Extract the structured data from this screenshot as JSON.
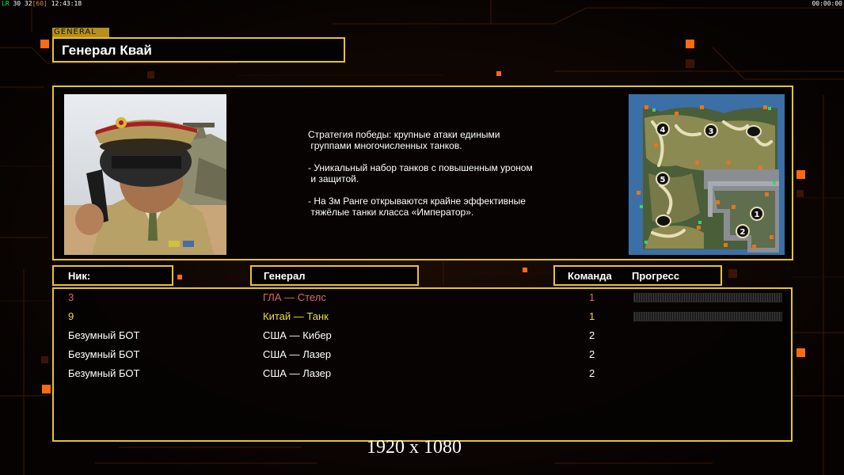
{
  "hud": {
    "fps_prefix": "LR",
    "fps_values": "30 32",
    "fps_bracket": "[60]",
    "clock": "12:43:18",
    "timer": "00:00:00"
  },
  "general": {
    "tag": "GENERAL",
    "name": "Генерал Квай"
  },
  "description": [
    "Стратегия победы: крупные атаки едиными\n группами многочисленных танков.",
    "- Уникальный набор танков с повышенным уроном\n и защитой.",
    "- На 3м Ранге открываются крайне эффективные\n тяжёлые танки класса «Император»."
  ],
  "minimap": {
    "start_positions": [
      "1",
      "2",
      "3",
      "4",
      "5"
    ]
  },
  "table": {
    "headers": {
      "nick": "Ник:",
      "general": "Генерал",
      "team": "Команда",
      "progress": "Прогресс"
    },
    "rows": [
      {
        "nick": "3",
        "general": "ГЛА — Стелс",
        "team": "1",
        "color": "#e0676a",
        "progress": 0
      },
      {
        "nick": "9",
        "general": "Китай — Танк",
        "team": "1",
        "color": "#f0de32",
        "progress": 0
      },
      {
        "nick": "Безумный БОТ",
        "general": "США — Кибер",
        "team": "2",
        "color": "#ffffff"
      },
      {
        "nick": "Безумный БОТ",
        "general": "США — Лазер",
        "team": "2",
        "color": "#ffffff"
      },
      {
        "nick": "Безумный БОТ",
        "general": "США — Лазер",
        "team": "2",
        "color": "#ffffff"
      }
    ]
  },
  "resolution_label": "1920 x 1080",
  "colors": {
    "frame": "#e8c32c",
    "accent": "#ff6a10",
    "background": "#070302"
  }
}
